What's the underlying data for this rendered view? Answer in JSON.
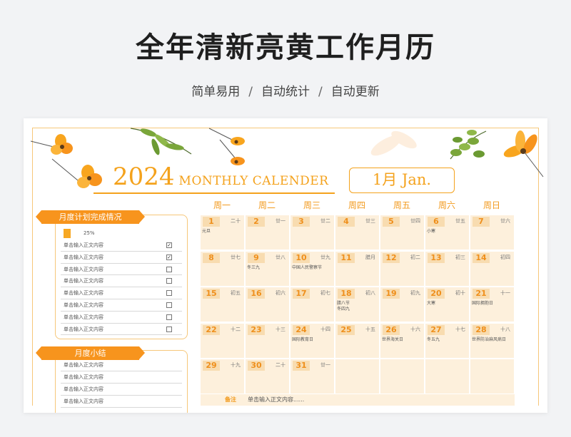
{
  "header": {
    "title": "全年清新亮黄工作月历",
    "sub_1": "简单易用",
    "sub_2": "自动统计",
    "sub_3": "自动更新",
    "sep": "/"
  },
  "calendar": {
    "year": "2024",
    "subtitle": "MONTHLY CALENDER",
    "month": "1月 Jan.",
    "weekdays": [
      "周一",
      "周二",
      "周三",
      "周四",
      "周五",
      "周六",
      "周日"
    ],
    "days": [
      {
        "d": "1",
        "l": "二十",
        "f": [
          "元旦"
        ]
      },
      {
        "d": "2",
        "l": "廿一",
        "f": []
      },
      {
        "d": "3",
        "l": "廿二",
        "f": []
      },
      {
        "d": "4",
        "l": "廿三",
        "f": []
      },
      {
        "d": "5",
        "l": "廿四",
        "f": []
      },
      {
        "d": "6",
        "l": "廿五",
        "f": [
          "小寒"
        ]
      },
      {
        "d": "7",
        "l": "廿六",
        "f": []
      },
      {
        "d": "8",
        "l": "廿七",
        "f": []
      },
      {
        "d": "9",
        "l": "廿八",
        "f": [
          "冬三九"
        ]
      },
      {
        "d": "10",
        "l": "廿九",
        "f": [
          "中国人民警察节"
        ]
      },
      {
        "d": "11",
        "l": "腊月",
        "f": []
      },
      {
        "d": "12",
        "l": "初二",
        "f": []
      },
      {
        "d": "13",
        "l": "初三",
        "f": []
      },
      {
        "d": "14",
        "l": "初四",
        "f": []
      },
      {
        "d": "15",
        "l": "初五",
        "f": []
      },
      {
        "d": "16",
        "l": "初六",
        "f": []
      },
      {
        "d": "17",
        "l": "初七",
        "f": []
      },
      {
        "d": "18",
        "l": "初八",
        "f": [
          "腊八节",
          "冬四九"
        ]
      },
      {
        "d": "19",
        "l": "初九",
        "f": []
      },
      {
        "d": "20",
        "l": "初十",
        "f": [
          "大寒"
        ]
      },
      {
        "d": "21",
        "l": "十一",
        "f": [
          "国际拥抱日"
        ]
      },
      {
        "d": "22",
        "l": "十二",
        "f": []
      },
      {
        "d": "23",
        "l": "十三",
        "f": []
      },
      {
        "d": "24",
        "l": "十四",
        "f": [
          "国际教育日"
        ]
      },
      {
        "d": "25",
        "l": "十五",
        "f": []
      },
      {
        "d": "26",
        "l": "十六",
        "f": [
          "世界海关日"
        ]
      },
      {
        "d": "27",
        "l": "十七",
        "f": [
          "冬五九"
        ]
      },
      {
        "d": "28",
        "l": "十八",
        "f": [
          "世界防治麻风病日"
        ]
      },
      {
        "d": "29",
        "l": "十九",
        "f": []
      },
      {
        "d": "30",
        "l": "二十",
        "f": []
      },
      {
        "d": "31",
        "l": "廿一",
        "f": []
      }
    ],
    "notes_label": "备注",
    "notes_text": "单击输入正文内容......"
  },
  "plan": {
    "title": "月度计划完成情况",
    "progress": 0.25,
    "progress_label": "25%",
    "tasks": [
      {
        "text": "单击输入正文内容",
        "done": true
      },
      {
        "text": "单击输入正文内容",
        "done": true
      },
      {
        "text": "单击输入正文内容",
        "done": false
      },
      {
        "text": "单击输入正文内容",
        "done": false
      },
      {
        "text": "单击输入正文内容",
        "done": false
      },
      {
        "text": "单击输入正文内容",
        "done": false
      },
      {
        "text": "单击输入正文内容",
        "done": false
      },
      {
        "text": "单击输入正文内容",
        "done": false
      }
    ],
    "check_mark": "✓"
  },
  "summary": {
    "title": "月度小结",
    "rows": [
      "单击输入正文内容",
      "单击输入正文内容",
      "单击输入正文内容",
      "单击输入正文内容"
    ]
  },
  "colors": {
    "accent": "#f4a21c",
    "cell_bg": "#fdf0dc",
    "ribbon": "#f7941d"
  }
}
